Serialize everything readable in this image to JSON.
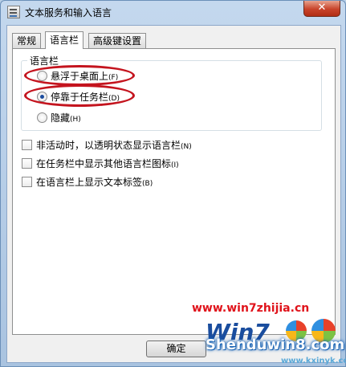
{
  "window": {
    "title": "文本服务和输入语言",
    "close_glyph": "✕"
  },
  "tabs": [
    {
      "label": "常规",
      "active": false
    },
    {
      "label": "语言栏",
      "active": true
    },
    {
      "label": "高级键设置",
      "active": false
    }
  ],
  "language_bar": {
    "group_label": "语言栏",
    "options": [
      {
        "label": "悬浮于桌面上",
        "hotkey": "(F)",
        "selected": false
      },
      {
        "label": "停靠于任务栏",
        "hotkey": "(D)",
        "selected": true
      },
      {
        "label": "隐藏",
        "hotkey": "(H)",
        "selected": false
      }
    ]
  },
  "checkboxes": [
    {
      "label": "非活动时，以透明状态显示语言栏",
      "hotkey": "(N)",
      "checked": false
    },
    {
      "label": "在任务栏中显示其他语言栏图标",
      "hotkey": "(I)",
      "checked": false
    },
    {
      "label": "在语言栏上显示文本标签",
      "hotkey": "(B)",
      "checked": false
    }
  ],
  "buttons": {
    "ok": "确定"
  },
  "watermark": {
    "url_text": "www.win7zhijia.cn",
    "logo_text": "Win7",
    "site_text": "Shenduwin8.com",
    "site_url": "www.kxinyk.com"
  },
  "colors": {
    "annotation": "#c4141e",
    "watermark": "#e0131b"
  }
}
